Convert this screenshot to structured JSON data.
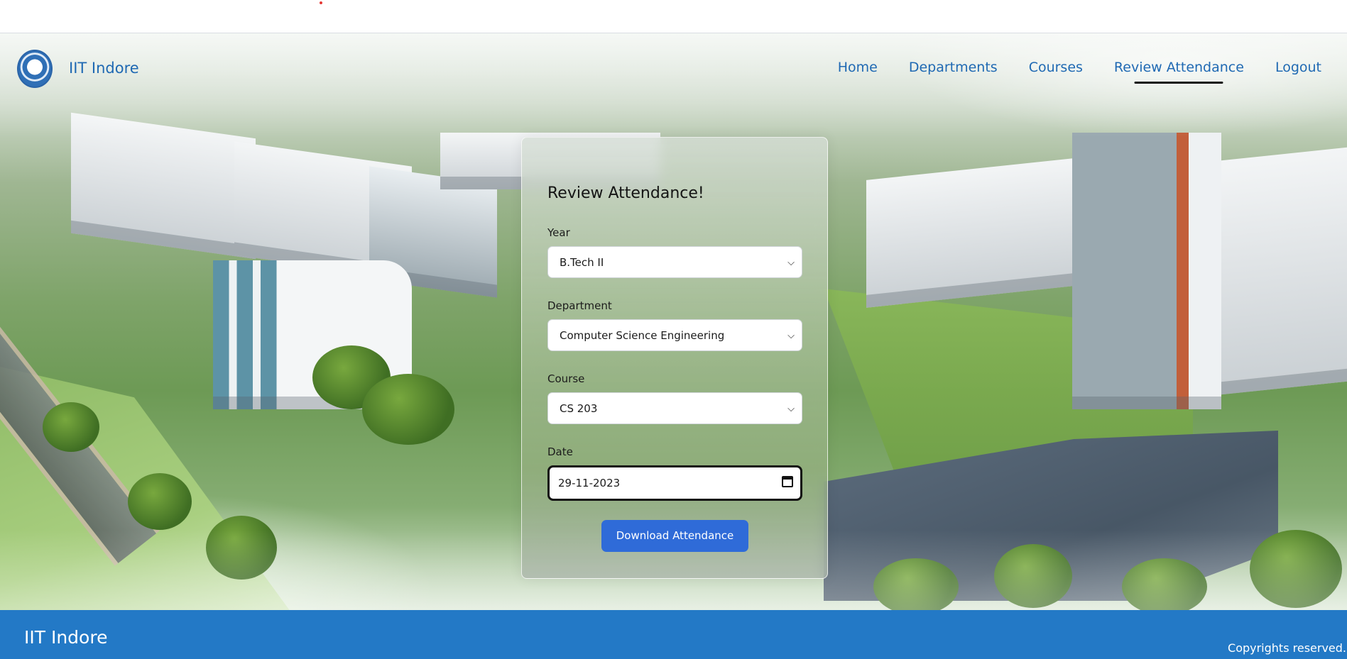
{
  "navbar": {
    "brand": "IIT Indore",
    "links": [
      "Home",
      "Departments",
      "Courses",
      "Review Attendance",
      "Logout"
    ],
    "active": "Review Attendance"
  },
  "form": {
    "title": "Review Attendance!",
    "year": {
      "label": "Year",
      "value": "B.Tech II"
    },
    "department": {
      "label": "Department",
      "value": "Computer Science Engineering"
    },
    "course": {
      "label": "Course",
      "value": "CS 203"
    },
    "date": {
      "label": "Date",
      "value": "29-11-2023"
    },
    "download_label": "Download Attendance"
  },
  "footer": {
    "brand": "IIT Indore",
    "copyright": "Copyrights reserved."
  },
  "colors": {
    "brand_blue": "#1f69b3",
    "footer_blue": "#2379c6",
    "button_blue": "#2f6bd8"
  }
}
